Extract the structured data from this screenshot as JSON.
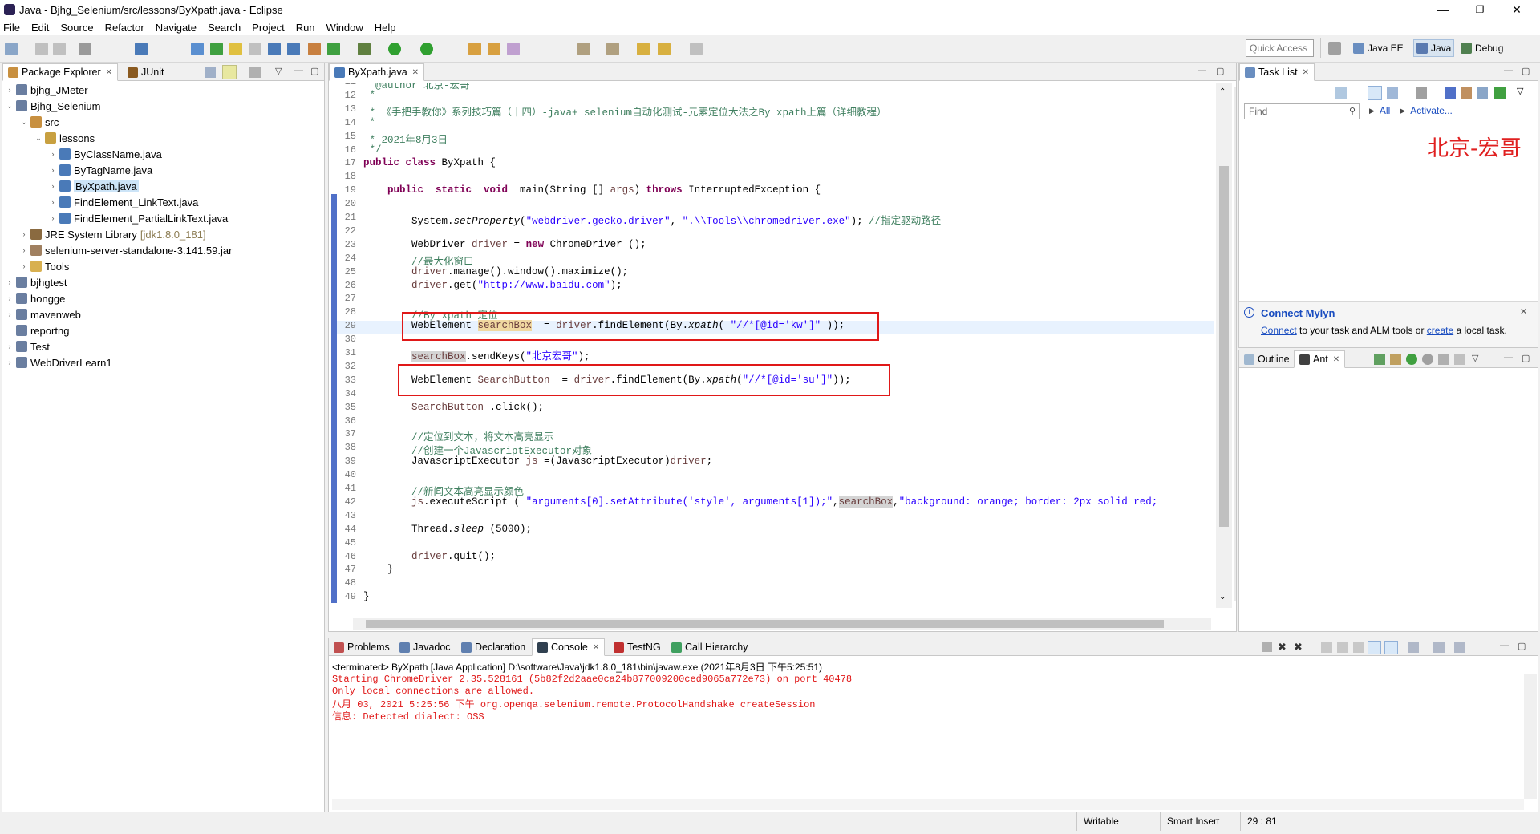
{
  "window": {
    "title": "Java - Bjhg_Selenium/src/lessons/ByXpath.java - Eclipse",
    "minimize": "—",
    "maximize": "❐",
    "close": "✕"
  },
  "menu": [
    "File",
    "Edit",
    "Source",
    "Refactor",
    "Navigate",
    "Search",
    "Project",
    "Run",
    "Window",
    "Help"
  ],
  "toolbar": {
    "quick_access_placeholder": "Quick Access",
    "perspectives": [
      "Java EE",
      "Java",
      "Debug"
    ]
  },
  "left_panel": {
    "tabs": [
      "Package Explorer",
      "JUnit"
    ],
    "tree": [
      {
        "label": "bjhg_JMeter",
        "twisty": "›",
        "icon": "project-icon"
      },
      {
        "label": "Bjhg_Selenium",
        "twisty": "⌄",
        "icon": "project-icon"
      },
      {
        "label": "src",
        "twisty": "⌄",
        "icon": "source-folder-icon"
      },
      {
        "label": "lessons",
        "twisty": "⌄",
        "icon": "package-icon"
      },
      {
        "label": "ByClassName.java",
        "twisty": "›",
        "icon": "java-file-icon"
      },
      {
        "label": "ByTagName.java",
        "twisty": "›",
        "icon": "java-file-icon"
      },
      {
        "label": "ByXpath.java",
        "twisty": "›",
        "icon": "java-file-icon"
      },
      {
        "label": "FindElement_LinkText.java",
        "twisty": "›",
        "icon": "java-file-icon"
      },
      {
        "label": "FindElement_PartialLinkText.java",
        "twisty": "›",
        "icon": "java-file-icon"
      },
      {
        "label": "JRE System Library",
        "suffix": "[jdk1.8.0_181]",
        "twisty": "›",
        "icon": "library-icon"
      },
      {
        "label": "selenium-server-standalone-3.141.59.jar",
        "twisty": "›",
        "icon": "jar-icon"
      },
      {
        "label": "Tools",
        "twisty": "›",
        "icon": "folder-icon"
      },
      {
        "label": "bjhgtest",
        "twisty": "›",
        "icon": "project-icon"
      },
      {
        "label": "hongge",
        "twisty": "›",
        "icon": "project-icon"
      },
      {
        "label": "mavenweb",
        "twisty": "›",
        "icon": "project-icon"
      },
      {
        "label": "reportng",
        "twisty": "",
        "icon": "project-icon"
      },
      {
        "label": "Test",
        "twisty": "›",
        "icon": "project-icon"
      },
      {
        "label": "WebDriverLearn1",
        "twisty": "›",
        "icon": "project-icon"
      }
    ]
  },
  "editor": {
    "tab": "ByXpath.java",
    "lines": [
      {
        "n": "11",
        "segs": [
          {
            "t": "  @author 北京-宏哥",
            "c": "cm"
          }
        ]
      },
      {
        "n": "12",
        "segs": [
          {
            "t": " *",
            "c": "cm"
          }
        ]
      },
      {
        "n": "13",
        "segs": [
          {
            "t": " * 《手把手教你》系列技巧篇（十四）-java+ selenium自动化测试-元素定位大法之By xpath上篇（详细教程）",
            "c": "cm"
          }
        ]
      },
      {
        "n": "14",
        "segs": [
          {
            "t": " *",
            "c": "cm"
          }
        ]
      },
      {
        "n": "15",
        "segs": [
          {
            "t": " * 2021年8月3日",
            "c": "cm"
          }
        ]
      },
      {
        "n": "16",
        "segs": [
          {
            "t": " */",
            "c": "cm"
          }
        ]
      },
      {
        "n": "17",
        "segs": [
          {
            "t": "public class",
            "c": "kw"
          },
          {
            "t": " ByXpath {",
            "c": ""
          }
        ]
      },
      {
        "n": "18",
        "segs": []
      },
      {
        "n": "19",
        "segs": [
          {
            "t": "    ",
            "c": ""
          },
          {
            "t": "public  static  void",
            "c": "kw"
          },
          {
            "t": "  main(String [] ",
            "c": ""
          },
          {
            "t": "args",
            "c": "var"
          },
          {
            "t": ") ",
            "c": ""
          },
          {
            "t": "throws",
            "c": "kw"
          },
          {
            "t": " InterruptedException {",
            "c": ""
          }
        ]
      },
      {
        "n": "20",
        "segs": []
      },
      {
        "n": "21",
        "segs": [
          {
            "t": "        System.",
            "c": ""
          },
          {
            "t": "setProperty",
            "c": "ital"
          },
          {
            "t": "(",
            "c": ""
          },
          {
            "t": "\"webdriver.gecko.driver\"",
            "c": "str"
          },
          {
            "t": ", ",
            "c": ""
          },
          {
            "t": "\".\\\\Tools\\\\chromedriver.exe\"",
            "c": "str"
          },
          {
            "t": "); ",
            "c": ""
          },
          {
            "t": "//指定驱动路径",
            "c": "cm"
          }
        ]
      },
      {
        "n": "22",
        "segs": []
      },
      {
        "n": "23",
        "segs": [
          {
            "t": "        WebDriver ",
            "c": ""
          },
          {
            "t": "driver",
            "c": "var"
          },
          {
            "t": " = ",
            "c": ""
          },
          {
            "t": "new",
            "c": "kw"
          },
          {
            "t": " ChromeDriver ();",
            "c": ""
          }
        ]
      },
      {
        "n": "24",
        "segs": [
          {
            "t": "        //最大化窗口",
            "c": "cm"
          }
        ]
      },
      {
        "n": "25",
        "segs": [
          {
            "t": "        ",
            "c": ""
          },
          {
            "t": "driver",
            "c": "var"
          },
          {
            "t": ".manage().window().maximize();",
            "c": ""
          }
        ]
      },
      {
        "n": "26",
        "segs": [
          {
            "t": "        ",
            "c": ""
          },
          {
            "t": "driver",
            "c": "var"
          },
          {
            "t": ".get(",
            "c": ""
          },
          {
            "t": "\"http://www.baidu.com\"",
            "c": "str"
          },
          {
            "t": ");",
            "c": ""
          }
        ]
      },
      {
        "n": "27",
        "segs": []
      },
      {
        "n": "28",
        "segs": [
          {
            "t": "        //By xpath 定位",
            "c": "cm"
          }
        ]
      },
      {
        "n": "29",
        "segs": [
          {
            "t": "        WebElement ",
            "c": ""
          },
          {
            "t": "searchBox",
            "c": "var hlv2"
          },
          {
            "t": "  = ",
            "c": ""
          },
          {
            "t": "driver",
            "c": "var"
          },
          {
            "t": ".findElement(By.",
            "c": ""
          },
          {
            "t": "xpath",
            "c": "ital"
          },
          {
            "t": "( ",
            "c": ""
          },
          {
            "t": "\"//*[@id='kw']\"",
            "c": "str"
          },
          {
            "t": " ));",
            "c": ""
          }
        ]
      },
      {
        "n": "30",
        "segs": []
      },
      {
        "n": "31",
        "segs": [
          {
            "t": "        ",
            "c": ""
          },
          {
            "t": "searchBox",
            "c": "var hlv"
          },
          {
            "t": ".sendKeys(",
            "c": ""
          },
          {
            "t": "\"北京宏哥\"",
            "c": "str"
          },
          {
            "t": ");",
            "c": ""
          }
        ]
      },
      {
        "n": "32",
        "segs": []
      },
      {
        "n": "33",
        "segs": [
          {
            "t": "        WebElement ",
            "c": ""
          },
          {
            "t": "SearchButton",
            "c": "var"
          },
          {
            "t": "  = ",
            "c": ""
          },
          {
            "t": "driver",
            "c": "var"
          },
          {
            "t": ".findElement(By.",
            "c": ""
          },
          {
            "t": "xpath",
            "c": "ital"
          },
          {
            "t": "(",
            "c": ""
          },
          {
            "t": "\"//*[@id='su']\"",
            "c": "str"
          },
          {
            "t": "));",
            "c": ""
          }
        ]
      },
      {
        "n": "34",
        "segs": []
      },
      {
        "n": "35",
        "segs": [
          {
            "t": "        ",
            "c": ""
          },
          {
            "t": "SearchButton",
            "c": "var"
          },
          {
            "t": " .click();",
            "c": ""
          }
        ]
      },
      {
        "n": "36",
        "segs": []
      },
      {
        "n": "37",
        "segs": [
          {
            "t": "        //定位到文本，将文本高亮显示",
            "c": "cm"
          }
        ]
      },
      {
        "n": "38",
        "segs": [
          {
            "t": "        //创建一个JavascriptExecutor对象",
            "c": "cm"
          }
        ]
      },
      {
        "n": "39",
        "segs": [
          {
            "t": "        JavascriptExecutor ",
            "c": ""
          },
          {
            "t": "js",
            "c": "var"
          },
          {
            "t": " =(JavascriptExecutor)",
            "c": ""
          },
          {
            "t": "driver",
            "c": "var"
          },
          {
            "t": ";",
            "c": ""
          }
        ]
      },
      {
        "n": "40",
        "segs": []
      },
      {
        "n": "41",
        "segs": [
          {
            "t": "        //新闻文本高亮显示颜色",
            "c": "cm"
          }
        ]
      },
      {
        "n": "42",
        "segs": [
          {
            "t": "        ",
            "c": ""
          },
          {
            "t": "js",
            "c": "var"
          },
          {
            "t": ".executeScript ( ",
            "c": ""
          },
          {
            "t": "\"arguments[0].setAttribute('style', arguments[1]);\"",
            "c": "str"
          },
          {
            "t": ",",
            "c": ""
          },
          {
            "t": "searchBox",
            "c": "var hlv"
          },
          {
            "t": ",",
            "c": ""
          },
          {
            "t": "\"background: orange; border: 2px solid red;",
            "c": "str"
          }
        ]
      },
      {
        "n": "43",
        "segs": []
      },
      {
        "n": "44",
        "segs": [
          {
            "t": "        Thread.",
            "c": ""
          },
          {
            "t": "sleep",
            "c": "ital"
          },
          {
            "t": " (5000);",
            "c": ""
          }
        ]
      },
      {
        "n": "45",
        "segs": []
      },
      {
        "n": "46",
        "segs": [
          {
            "t": "        ",
            "c": ""
          },
          {
            "t": "driver",
            "c": "var"
          },
          {
            "t": ".quit();",
            "c": ""
          }
        ]
      },
      {
        "n": "47",
        "segs": [
          {
            "t": "    }",
            "c": ""
          }
        ]
      },
      {
        "n": "48",
        "segs": []
      },
      {
        "n": "49",
        "segs": [
          {
            "t": "}",
            "c": ""
          }
        ]
      },
      {
        "n": "50",
        "segs": []
      }
    ]
  },
  "right_panel": {
    "task_tab": "Task List",
    "find_placeholder": "Find",
    "all_label": "All",
    "activate_label": "Activate...",
    "watermark": "北京-宏哥",
    "mylyn_title": "Connect Mylyn",
    "mylyn_text_connect": "Connect",
    "mylyn_text_mid": " to your task and ALM tools or ",
    "mylyn_text_create": "create",
    "mylyn_text_end": " a local task.",
    "outline_tabs": [
      "Outline",
      "Ant"
    ]
  },
  "bottom_panel": {
    "tabs": [
      "Problems",
      "Javadoc",
      "Declaration",
      "Console",
      "TestNG",
      "Call Hierarchy"
    ],
    "terminated": "<terminated> ByXpath [Java Application] D:\\software\\Java\\jdk1.8.0_181\\bin\\javaw.exe (2021年8月3日 下午5:25:51)",
    "console_lines": [
      "Starting ChromeDriver 2.35.528161 (5b82f2d2aae0ca24b877009200ced9065a772e73) on port 40478",
      "Only local connections are allowed.",
      "八月 03, 2021 5:25:56 下午 org.openqa.selenium.remote.ProtocolHandshake createSession",
      "信息: Detected dialect: OSS"
    ]
  },
  "status": {
    "writable": "Writable",
    "insert": "Smart Insert",
    "position": "29 : 81"
  },
  "colors": {
    "keyword": "#7f0055",
    "string": "#2a00ff",
    "comment": "#3f7f5f",
    "console_error": "#e01818",
    "annotation_box": "#e01818"
  }
}
